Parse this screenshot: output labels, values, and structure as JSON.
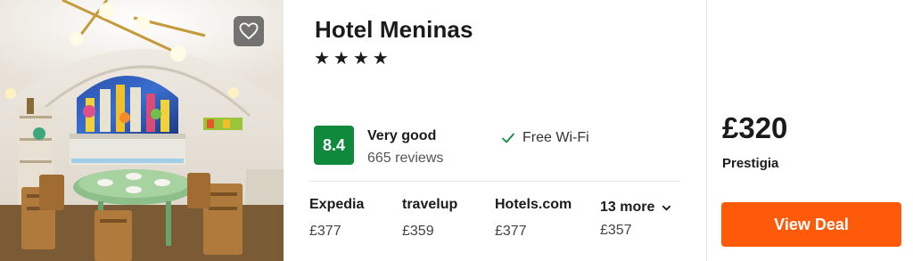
{
  "hotel": {
    "name": "Hotel Meninas",
    "stars_text": "★★★★",
    "star_count": 4
  },
  "rating": {
    "score": "8.4",
    "label": "Very good",
    "reviews": "665 reviews",
    "badge_color": "#0f8a3c"
  },
  "amenities": [
    {
      "label": "Free Wi-Fi",
      "icon": "check-icon"
    }
  ],
  "providers": [
    {
      "name": "Expedia",
      "price": "£377"
    },
    {
      "name": "travelup",
      "price": "£359"
    },
    {
      "name": "Hotels.com",
      "price": "£377"
    }
  ],
  "more": {
    "label": "13 more",
    "price": "£357",
    "icon": "chevron-down-icon"
  },
  "deal": {
    "price": "£320",
    "provider": "Prestigia",
    "button_label": "View Deal",
    "button_color": "#ff5a0a"
  },
  "photo": {
    "favorite_icon": "heart-icon"
  }
}
